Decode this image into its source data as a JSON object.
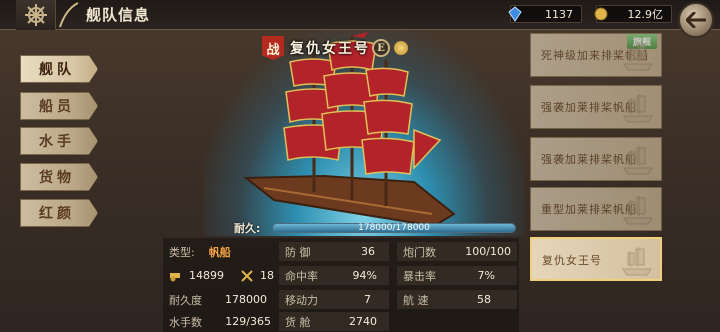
{
  "header": {
    "title": "舰队信息",
    "gems": "1137",
    "gold": "12.9亿"
  },
  "tabs": [
    {
      "label": "舰队",
      "active": true
    },
    {
      "label": "船员",
      "active": false
    },
    {
      "label": "水手",
      "active": false
    },
    {
      "label": "货物",
      "active": false
    },
    {
      "label": "红颜",
      "active": false
    }
  ],
  "ship": {
    "battle_badge": "战",
    "name": "复仇女王号",
    "rank_badge": "E",
    "durability_label": "耐久:",
    "durability_text": "178000/178000",
    "durability_fraction": 1.0
  },
  "stats": {
    "type_label": "类型:",
    "type_value": "帆船",
    "power_value": "14899",
    "crossed_value": "18",
    "durability_label": "耐久度",
    "durability_value": "178000",
    "sailors_label": "水手数",
    "sailors_value": "129/365",
    "defense_label": "防 御",
    "defense_value": "36",
    "hit_label": "命中率",
    "hit_value": "94%",
    "move_label": "移动力",
    "move_value": "7",
    "cargo_label": "货 舱",
    "cargo_value": "2740",
    "cannon_label": "炮门数",
    "cannon_value": "100/100",
    "crit_label": "暴击率",
    "crit_value": "7%",
    "speed_label": "航 速",
    "speed_value": "58"
  },
  "shiplist": {
    "flagship_tag": "旗舰",
    "items": [
      {
        "name": "死神级加来排桨帆船",
        "flagship": true,
        "selected": false
      },
      {
        "name": "强袭加莱排桨帆船",
        "flagship": false,
        "selected": false
      },
      {
        "name": "强袭加莱排桨帆船",
        "flagship": false,
        "selected": false
      },
      {
        "name": "重型加莱排桨帆船",
        "flagship": false,
        "selected": false
      },
      {
        "name": "复仇女王号",
        "flagship": false,
        "selected": true
      }
    ]
  },
  "colors": {
    "accent_red": "#b42a1f",
    "ship_type_orange": "#f0a041",
    "flagship_green": "#6dbb68",
    "sea_blue": "#2e8fb0"
  }
}
